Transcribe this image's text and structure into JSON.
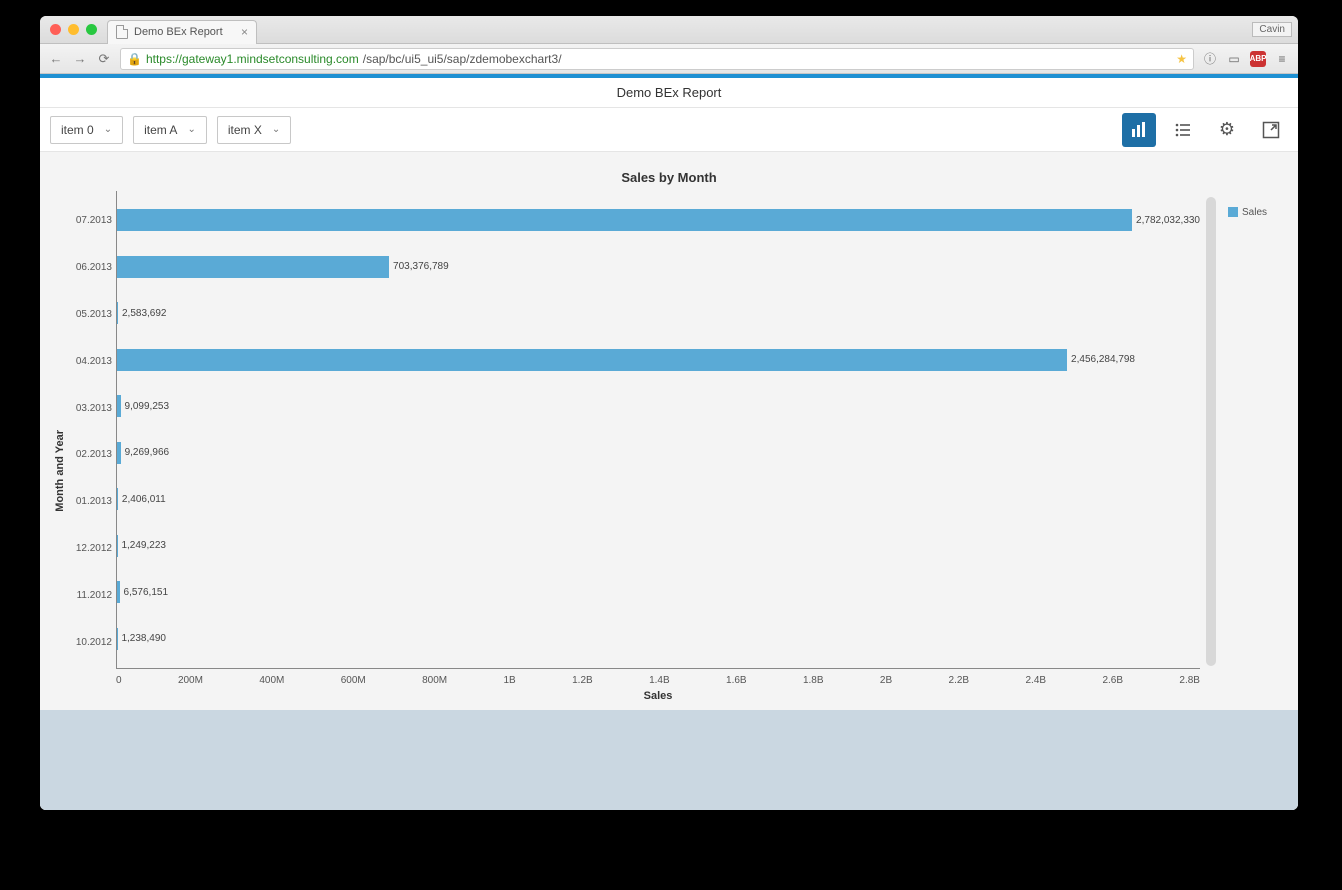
{
  "browser": {
    "tab_title": "Demo BEx Report",
    "user_badge": "Cavin",
    "url_host": "https://gateway1.mindsetconsulting.com",
    "url_path": "/sap/bc/ui5_ui5/sap/zdemobexchart3/"
  },
  "app": {
    "header_title": "Demo BEx Report",
    "filters": [
      {
        "label": "item 0"
      },
      {
        "label": "item A"
      },
      {
        "label": "item X"
      }
    ],
    "toolbar_icons": [
      "chart-view",
      "list-view",
      "settings",
      "fullscreen"
    ]
  },
  "chart": {
    "title": "Sales by Month",
    "yaxis_title": "Month and Year",
    "xaxis_title": "Sales",
    "legend_label": "Sales",
    "xticks": [
      "0",
      "200M",
      "400M",
      "600M",
      "800M",
      "1B",
      "1.2B",
      "1.4B",
      "1.6B",
      "1.8B",
      "2B",
      "2.2B",
      "2.4B",
      "2.6B",
      "2.8B"
    ]
  },
  "chart_data": {
    "type": "bar",
    "orientation": "horizontal",
    "xlabel": "Sales",
    "ylabel": "Month and Year",
    "xlim": [
      0,
      2800000000
    ],
    "categories": [
      "07.2013",
      "06.2013",
      "05.2013",
      "04.2013",
      "03.2013",
      "02.2013",
      "01.2013",
      "12.2012",
      "11.2012",
      "10.2012"
    ],
    "series": [
      {
        "name": "Sales",
        "values": [
          2782032330,
          703376789,
          2583692,
          2456284798,
          9099253,
          9269966,
          2406011,
          1249223,
          6576151,
          1238490
        ],
        "value_labels": [
          "2,782,032,330",
          "703,376,789",
          "2,583,692",
          "2,456,284,798",
          "9,099,253",
          "9,269,966",
          "2,406,011",
          "1,249,223",
          "6,576,151",
          "1,238,490"
        ]
      }
    ]
  }
}
